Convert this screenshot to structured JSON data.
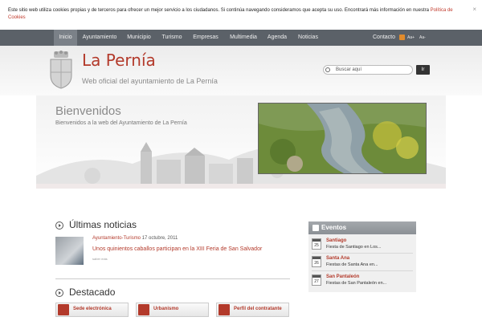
{
  "cookie": {
    "text": "Este sitio web utiliza cookies propias y de terceros para ofrecer un mejor servicio a los ciudadanos. Si continúa navegando consideramos que acepta su uso. Encontrará más información en nuestra ",
    "link_line1": "Política de",
    "link_line2": "Cookies",
    "close": "×"
  },
  "nav": {
    "items": [
      "Inicio",
      "Ayuntamiento",
      "Municipio",
      "Turismo",
      "Empresas",
      "Multimedia",
      "Agenda",
      "Noticias"
    ],
    "contact": "Contacto",
    "font_bigger": "Aa+",
    "font_smaller": "Aa-"
  },
  "header": {
    "title": "La Pernía",
    "subtitle": "Web oficial del ayuntamiento de La Pernía",
    "search_placeholder": "Buscar aquí",
    "search_button": "Ir"
  },
  "banner": {
    "title": "Bienvenidos",
    "subtitle": "Bienvenidos a la web del Ayuntamiento de La Pernía"
  },
  "news": {
    "heading": "Últimas noticias",
    "items": [
      {
        "category": "Ayuntamiento-Turismo",
        "date": "17 octubre, 2011",
        "title": "Unos quinientos caballos participan en la XIII Feria de San Salvador",
        "more": "saber más"
      }
    ]
  },
  "featured": {
    "heading": "Destacado",
    "items": [
      "Sede electrónica",
      "Urbanismo",
      "Perfil del contratante"
    ]
  },
  "events": {
    "heading": "Eventos",
    "items": [
      {
        "day": "25",
        "name": "Santiago",
        "desc": "Fiesta de Santiago en Los..."
      },
      {
        "day": "26",
        "name": "Santa Ana",
        "desc": "Fiestas de Santa Ana en..."
      },
      {
        "day": "27",
        "name": "San Pantaleón",
        "desc": "Fiestas de San Pantaleón en..."
      }
    ]
  },
  "colors": {
    "accent": "#b33a2b",
    "nav": "#5b6168"
  }
}
